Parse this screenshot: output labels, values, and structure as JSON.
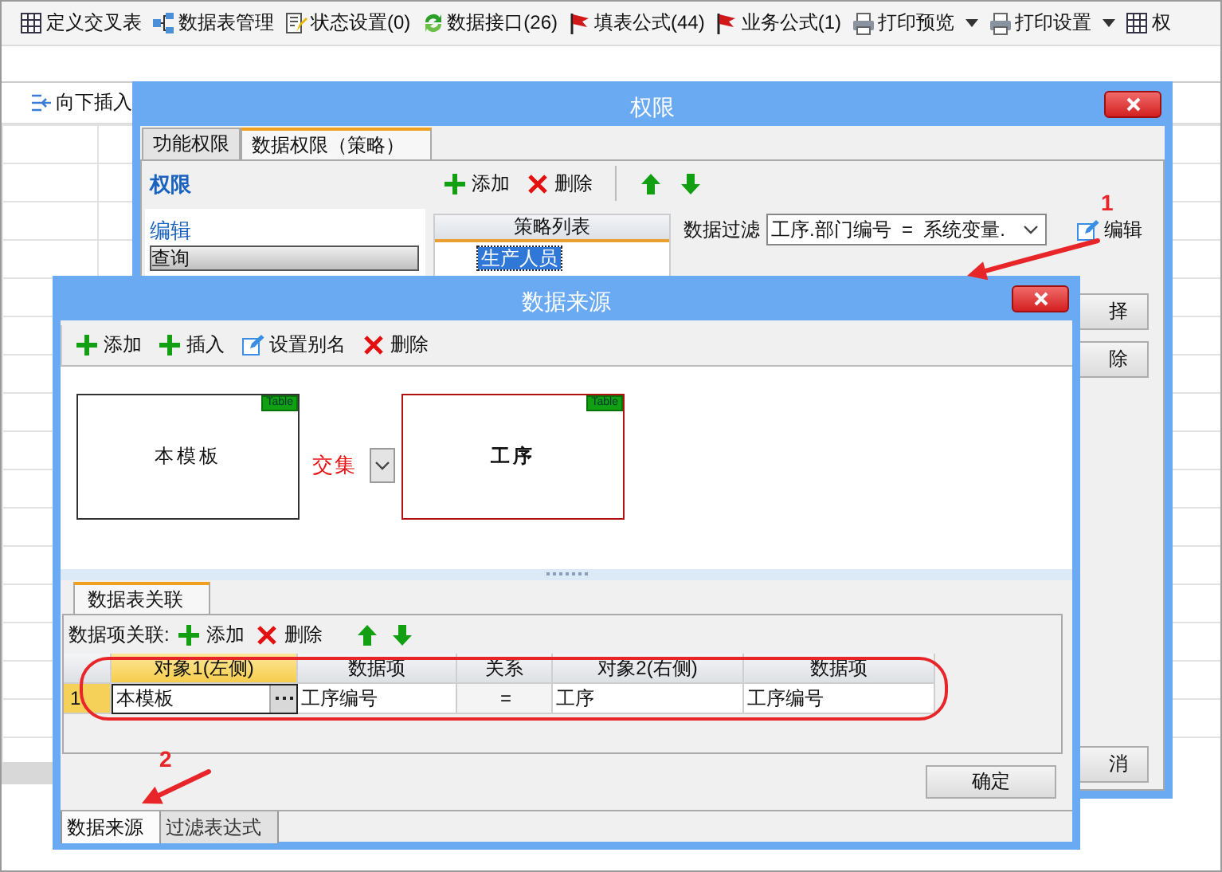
{
  "toolbar": {
    "items": [
      {
        "label": "定义交叉表",
        "dropdown": false
      },
      {
        "label": "数据表管理",
        "dropdown": false
      },
      {
        "label": "状态设置(0)",
        "dropdown": false
      },
      {
        "label": "数据接口(26)",
        "dropdown": false
      },
      {
        "label": "填表公式(44)",
        "dropdown": false
      },
      {
        "label": "业务公式(1)",
        "dropdown": false
      },
      {
        "label": "打印预览",
        "dropdown": true
      },
      {
        "label": "打印设置",
        "dropdown": true
      },
      {
        "label": "权",
        "dropdown": false
      }
    ]
  },
  "sheet_toolbar": {
    "items": [
      "向下插入"
    ]
  },
  "permission_dialog": {
    "title": "权限",
    "tabs": [
      {
        "label": "功能权限",
        "selected": false
      },
      {
        "label": "数据权限（策略）",
        "selected": true
      }
    ],
    "permission_header": "权限",
    "permissions": [
      {
        "label": "编辑",
        "selected": false
      },
      {
        "label": "查询",
        "selected": true
      }
    ],
    "toolbar": [
      {
        "kind": "add",
        "label": "添加"
      },
      {
        "kind": "delete",
        "label": "删除"
      },
      {
        "kind": "up"
      },
      {
        "kind": "down"
      }
    ],
    "policy_list": {
      "header": "策略列表",
      "items": [
        {
          "label": "生产人员",
          "selected": true
        }
      ]
    },
    "data_filter": {
      "label": "数据过滤",
      "value": "工序.部门编号  =  系统变量.",
      "edit_label": "编辑"
    },
    "side_buttons": [
      "择",
      "除"
    ],
    "cancel_button": "消"
  },
  "data_source_dialog": {
    "title": "数据来源",
    "toolbar": [
      {
        "kind": "add",
        "label": "添加"
      },
      {
        "kind": "add",
        "label": "插入"
      },
      {
        "kind": "edit",
        "label": "设置别名"
      },
      {
        "kind": "delete",
        "label": "删除"
      }
    ],
    "tables": [
      {
        "name": "本模板",
        "tag": "Table",
        "selected": false
      },
      {
        "name": "工序",
        "tag": "Table",
        "selected": true
      }
    ],
    "join": {
      "label": "交集"
    },
    "relation_tab": "数据表关联",
    "relation_toolbar": {
      "label": "数据项关联:",
      "buttons": [
        {
          "kind": "add",
          "label": "添加"
        },
        {
          "kind": "delete",
          "label": "删除"
        },
        {
          "kind": "up"
        },
        {
          "kind": "down"
        }
      ]
    },
    "grid": {
      "columns": [
        {
          "label": "对象1(左侧)",
          "selected": true
        },
        {
          "label": "数据项",
          "selected": false
        },
        {
          "label": "关系",
          "selected": false
        },
        {
          "label": "对象2(右侧)",
          "selected": false
        },
        {
          "label": "数据项",
          "selected": false
        }
      ],
      "rows": [
        {
          "number": "1",
          "selected": true,
          "cells": [
            "本模板",
            "工序编号",
            "=",
            "工序",
            "工序编号"
          ]
        }
      ]
    },
    "ok_button": "确定",
    "bottom_tabs": [
      {
        "label": "数据来源",
        "selected": true
      },
      {
        "label": "过滤表达式",
        "selected": false
      }
    ]
  },
  "annotations": [
    {
      "number": "1"
    },
    {
      "number": "2"
    }
  ]
}
